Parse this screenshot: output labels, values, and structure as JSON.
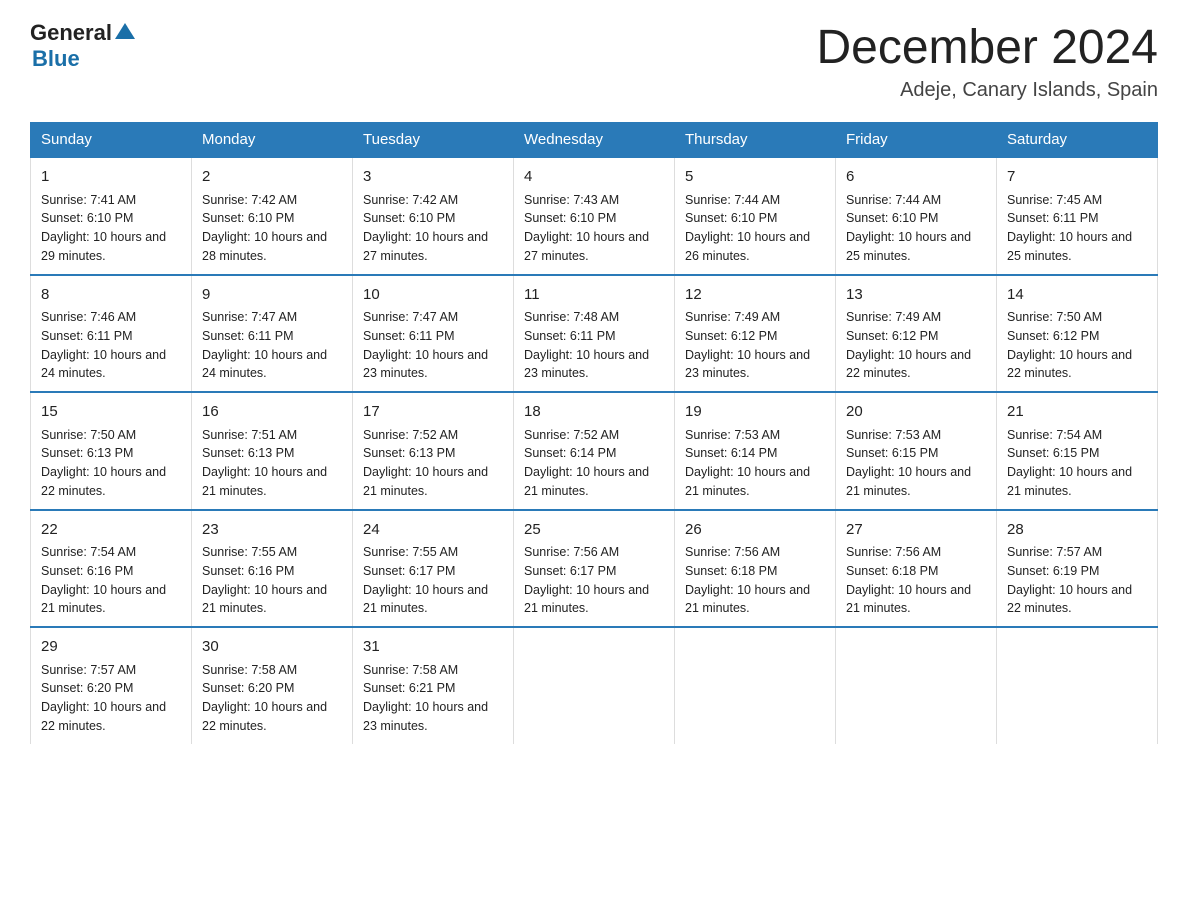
{
  "header": {
    "logo": {
      "general": "General",
      "blue": "Blue",
      "line2": "Blue"
    },
    "title": "December 2024",
    "location": "Adeje, Canary Islands, Spain"
  },
  "days_of_week": [
    "Sunday",
    "Monday",
    "Tuesday",
    "Wednesday",
    "Thursday",
    "Friday",
    "Saturday"
  ],
  "weeks": [
    [
      {
        "day": "1",
        "sunrise": "7:41 AM",
        "sunset": "6:10 PM",
        "daylight": "10 hours and 29 minutes."
      },
      {
        "day": "2",
        "sunrise": "7:42 AM",
        "sunset": "6:10 PM",
        "daylight": "10 hours and 28 minutes."
      },
      {
        "day": "3",
        "sunrise": "7:42 AM",
        "sunset": "6:10 PM",
        "daylight": "10 hours and 27 minutes."
      },
      {
        "day": "4",
        "sunrise": "7:43 AM",
        "sunset": "6:10 PM",
        "daylight": "10 hours and 27 minutes."
      },
      {
        "day": "5",
        "sunrise": "7:44 AM",
        "sunset": "6:10 PM",
        "daylight": "10 hours and 26 minutes."
      },
      {
        "day": "6",
        "sunrise": "7:44 AM",
        "sunset": "6:10 PM",
        "daylight": "10 hours and 25 minutes."
      },
      {
        "day": "7",
        "sunrise": "7:45 AM",
        "sunset": "6:11 PM",
        "daylight": "10 hours and 25 minutes."
      }
    ],
    [
      {
        "day": "8",
        "sunrise": "7:46 AM",
        "sunset": "6:11 PM",
        "daylight": "10 hours and 24 minutes."
      },
      {
        "day": "9",
        "sunrise": "7:47 AM",
        "sunset": "6:11 PM",
        "daylight": "10 hours and 24 minutes."
      },
      {
        "day": "10",
        "sunrise": "7:47 AM",
        "sunset": "6:11 PM",
        "daylight": "10 hours and 23 minutes."
      },
      {
        "day": "11",
        "sunrise": "7:48 AM",
        "sunset": "6:11 PM",
        "daylight": "10 hours and 23 minutes."
      },
      {
        "day": "12",
        "sunrise": "7:49 AM",
        "sunset": "6:12 PM",
        "daylight": "10 hours and 23 minutes."
      },
      {
        "day": "13",
        "sunrise": "7:49 AM",
        "sunset": "6:12 PM",
        "daylight": "10 hours and 22 minutes."
      },
      {
        "day": "14",
        "sunrise": "7:50 AM",
        "sunset": "6:12 PM",
        "daylight": "10 hours and 22 minutes."
      }
    ],
    [
      {
        "day": "15",
        "sunrise": "7:50 AM",
        "sunset": "6:13 PM",
        "daylight": "10 hours and 22 minutes."
      },
      {
        "day": "16",
        "sunrise": "7:51 AM",
        "sunset": "6:13 PM",
        "daylight": "10 hours and 21 minutes."
      },
      {
        "day": "17",
        "sunrise": "7:52 AM",
        "sunset": "6:13 PM",
        "daylight": "10 hours and 21 minutes."
      },
      {
        "day": "18",
        "sunrise": "7:52 AM",
        "sunset": "6:14 PM",
        "daylight": "10 hours and 21 minutes."
      },
      {
        "day": "19",
        "sunrise": "7:53 AM",
        "sunset": "6:14 PM",
        "daylight": "10 hours and 21 minutes."
      },
      {
        "day": "20",
        "sunrise": "7:53 AM",
        "sunset": "6:15 PM",
        "daylight": "10 hours and 21 minutes."
      },
      {
        "day": "21",
        "sunrise": "7:54 AM",
        "sunset": "6:15 PM",
        "daylight": "10 hours and 21 minutes."
      }
    ],
    [
      {
        "day": "22",
        "sunrise": "7:54 AM",
        "sunset": "6:16 PM",
        "daylight": "10 hours and 21 minutes."
      },
      {
        "day": "23",
        "sunrise": "7:55 AM",
        "sunset": "6:16 PM",
        "daylight": "10 hours and 21 minutes."
      },
      {
        "day": "24",
        "sunrise": "7:55 AM",
        "sunset": "6:17 PM",
        "daylight": "10 hours and 21 minutes."
      },
      {
        "day": "25",
        "sunrise": "7:56 AM",
        "sunset": "6:17 PM",
        "daylight": "10 hours and 21 minutes."
      },
      {
        "day": "26",
        "sunrise": "7:56 AM",
        "sunset": "6:18 PM",
        "daylight": "10 hours and 21 minutes."
      },
      {
        "day": "27",
        "sunrise": "7:56 AM",
        "sunset": "6:18 PM",
        "daylight": "10 hours and 21 minutes."
      },
      {
        "day": "28",
        "sunrise": "7:57 AM",
        "sunset": "6:19 PM",
        "daylight": "10 hours and 22 minutes."
      }
    ],
    [
      {
        "day": "29",
        "sunrise": "7:57 AM",
        "sunset": "6:20 PM",
        "daylight": "10 hours and 22 minutes."
      },
      {
        "day": "30",
        "sunrise": "7:58 AM",
        "sunset": "6:20 PM",
        "daylight": "10 hours and 22 minutes."
      },
      {
        "day": "31",
        "sunrise": "7:58 AM",
        "sunset": "6:21 PM",
        "daylight": "10 hours and 23 minutes."
      },
      null,
      null,
      null,
      null
    ]
  ],
  "labels": {
    "sunrise": "Sunrise:",
    "sunset": "Sunset:",
    "daylight": "Daylight:"
  }
}
